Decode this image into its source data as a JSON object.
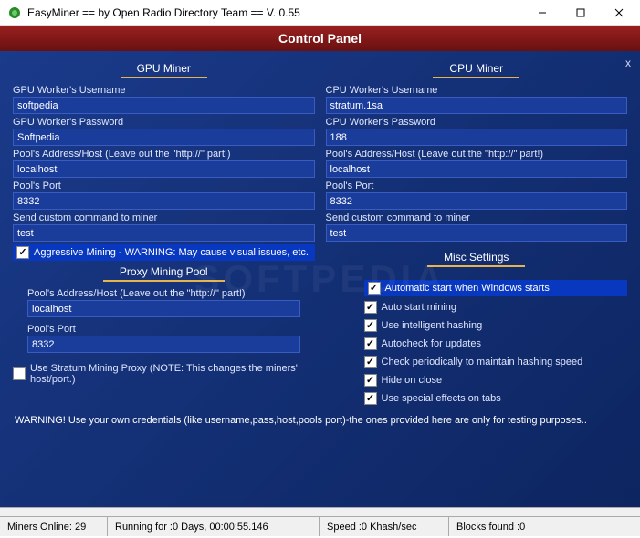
{
  "window": {
    "title": "EasyMiner == by Open Radio Directory Team == V. 0.55"
  },
  "header": "Control Panel",
  "gpu": {
    "title": "GPU Miner",
    "username_label": "GPU Worker's Username",
    "username": "softpedia",
    "password_label": "GPU Worker's Password",
    "password": "Softpedia",
    "host_label": "Pool's Address/Host (Leave out the \"http://\" part!)",
    "host": "localhost",
    "port_label": "Pool's Port",
    "port": "8332",
    "cmd_label": "Send custom command to miner",
    "cmd": "test",
    "aggressive_checked": true,
    "aggressive_label": "Aggressive Mining - WARNING: May cause visual issues, etc."
  },
  "proxy": {
    "title": "Proxy Mining Pool",
    "host_label": "Pool's Address/Host (Leave out the \"http://\" part!)",
    "host": "localhost",
    "port_label": "Pool's Port",
    "port": "8332",
    "stratum_checked": false,
    "stratum_label": "Use Stratum Mining Proxy (NOTE: This changes the miners' host/port.)"
  },
  "cpu": {
    "title": "CPU Miner",
    "username_label": "CPU Worker's Username",
    "username": "stratum.1sa",
    "password_label": "CPU Worker's Password",
    "password": "188",
    "host_label": "Pool's Address/Host (Leave out the \"http://\" part!)",
    "host": "localhost",
    "port_label": "Pool's Port",
    "port": "8332",
    "cmd_label": "Send custom command to miner",
    "cmd": "test"
  },
  "misc": {
    "title": "Misc Settings",
    "items": [
      {
        "checked": true,
        "highlight": true,
        "label": "Automatic start when Windows starts"
      },
      {
        "checked": true,
        "highlight": false,
        "label": "Auto start mining"
      },
      {
        "checked": true,
        "highlight": false,
        "label": "Use intelligent hashing"
      },
      {
        "checked": true,
        "highlight": false,
        "label": "Autocheck for updates"
      },
      {
        "checked": true,
        "highlight": false,
        "label": "Check periodically to maintain hashing speed"
      },
      {
        "checked": true,
        "highlight": false,
        "label": "Hide on close"
      },
      {
        "checked": true,
        "highlight": false,
        "label": "Use special effects on tabs"
      }
    ]
  },
  "warning": "WARNING! Use your own credentials (like username,pass,host,pools port)-the ones provided here are only for testing purposes..",
  "status": {
    "miners": "Miners Online: 29",
    "running": "Running for :0 Days, 00:00:55.146",
    "speed": "Speed :0 Khash/sec",
    "blocks": "Blocks found :0"
  }
}
